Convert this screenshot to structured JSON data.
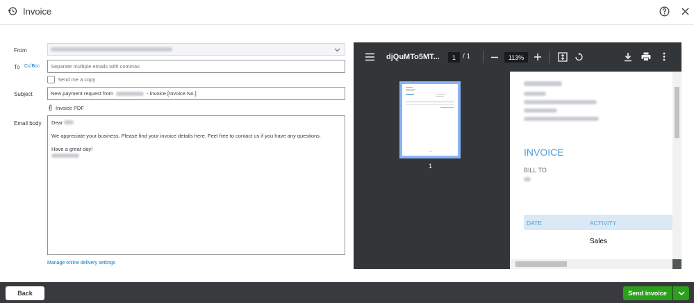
{
  "header": {
    "title": "Invoice"
  },
  "form": {
    "from_label": "From",
    "to_label": "To",
    "cc_bcc": "Cc/Bcc",
    "to_placeholder": "Separate multiple emails with commas",
    "send_copy": "Send me a copy",
    "subject_label": "Subject",
    "subject_prefix": "New payment request from",
    "subject_suffix": "- invoice [Invoice No.]",
    "attachment": "Invoice PDF",
    "body_label": "Email body",
    "body_greeting": "Dear",
    "body_line1": "We appreciate your business. Please find your invoice details here. Feel free to contact us if you have any questions.",
    "body_closing": "Have a great day!",
    "manage_link": "Manage online delivery settings"
  },
  "viewer": {
    "filename": "djQuMTo5MT...",
    "page_current": "1",
    "page_total": "/ 1",
    "zoom": "113%",
    "thumb_page": "1",
    "doc": {
      "title": "INVOICE",
      "bill_to": "BILL TO",
      "col_date": "DATE",
      "col_activity": "ACTIVITY",
      "row_activity": "Sales"
    }
  },
  "footer": {
    "back": "Back",
    "send": "Send invoice"
  },
  "colors": {
    "accent_green": "#2ca01c",
    "link_blue": "#0077c5",
    "viewer_bg": "#323639"
  }
}
